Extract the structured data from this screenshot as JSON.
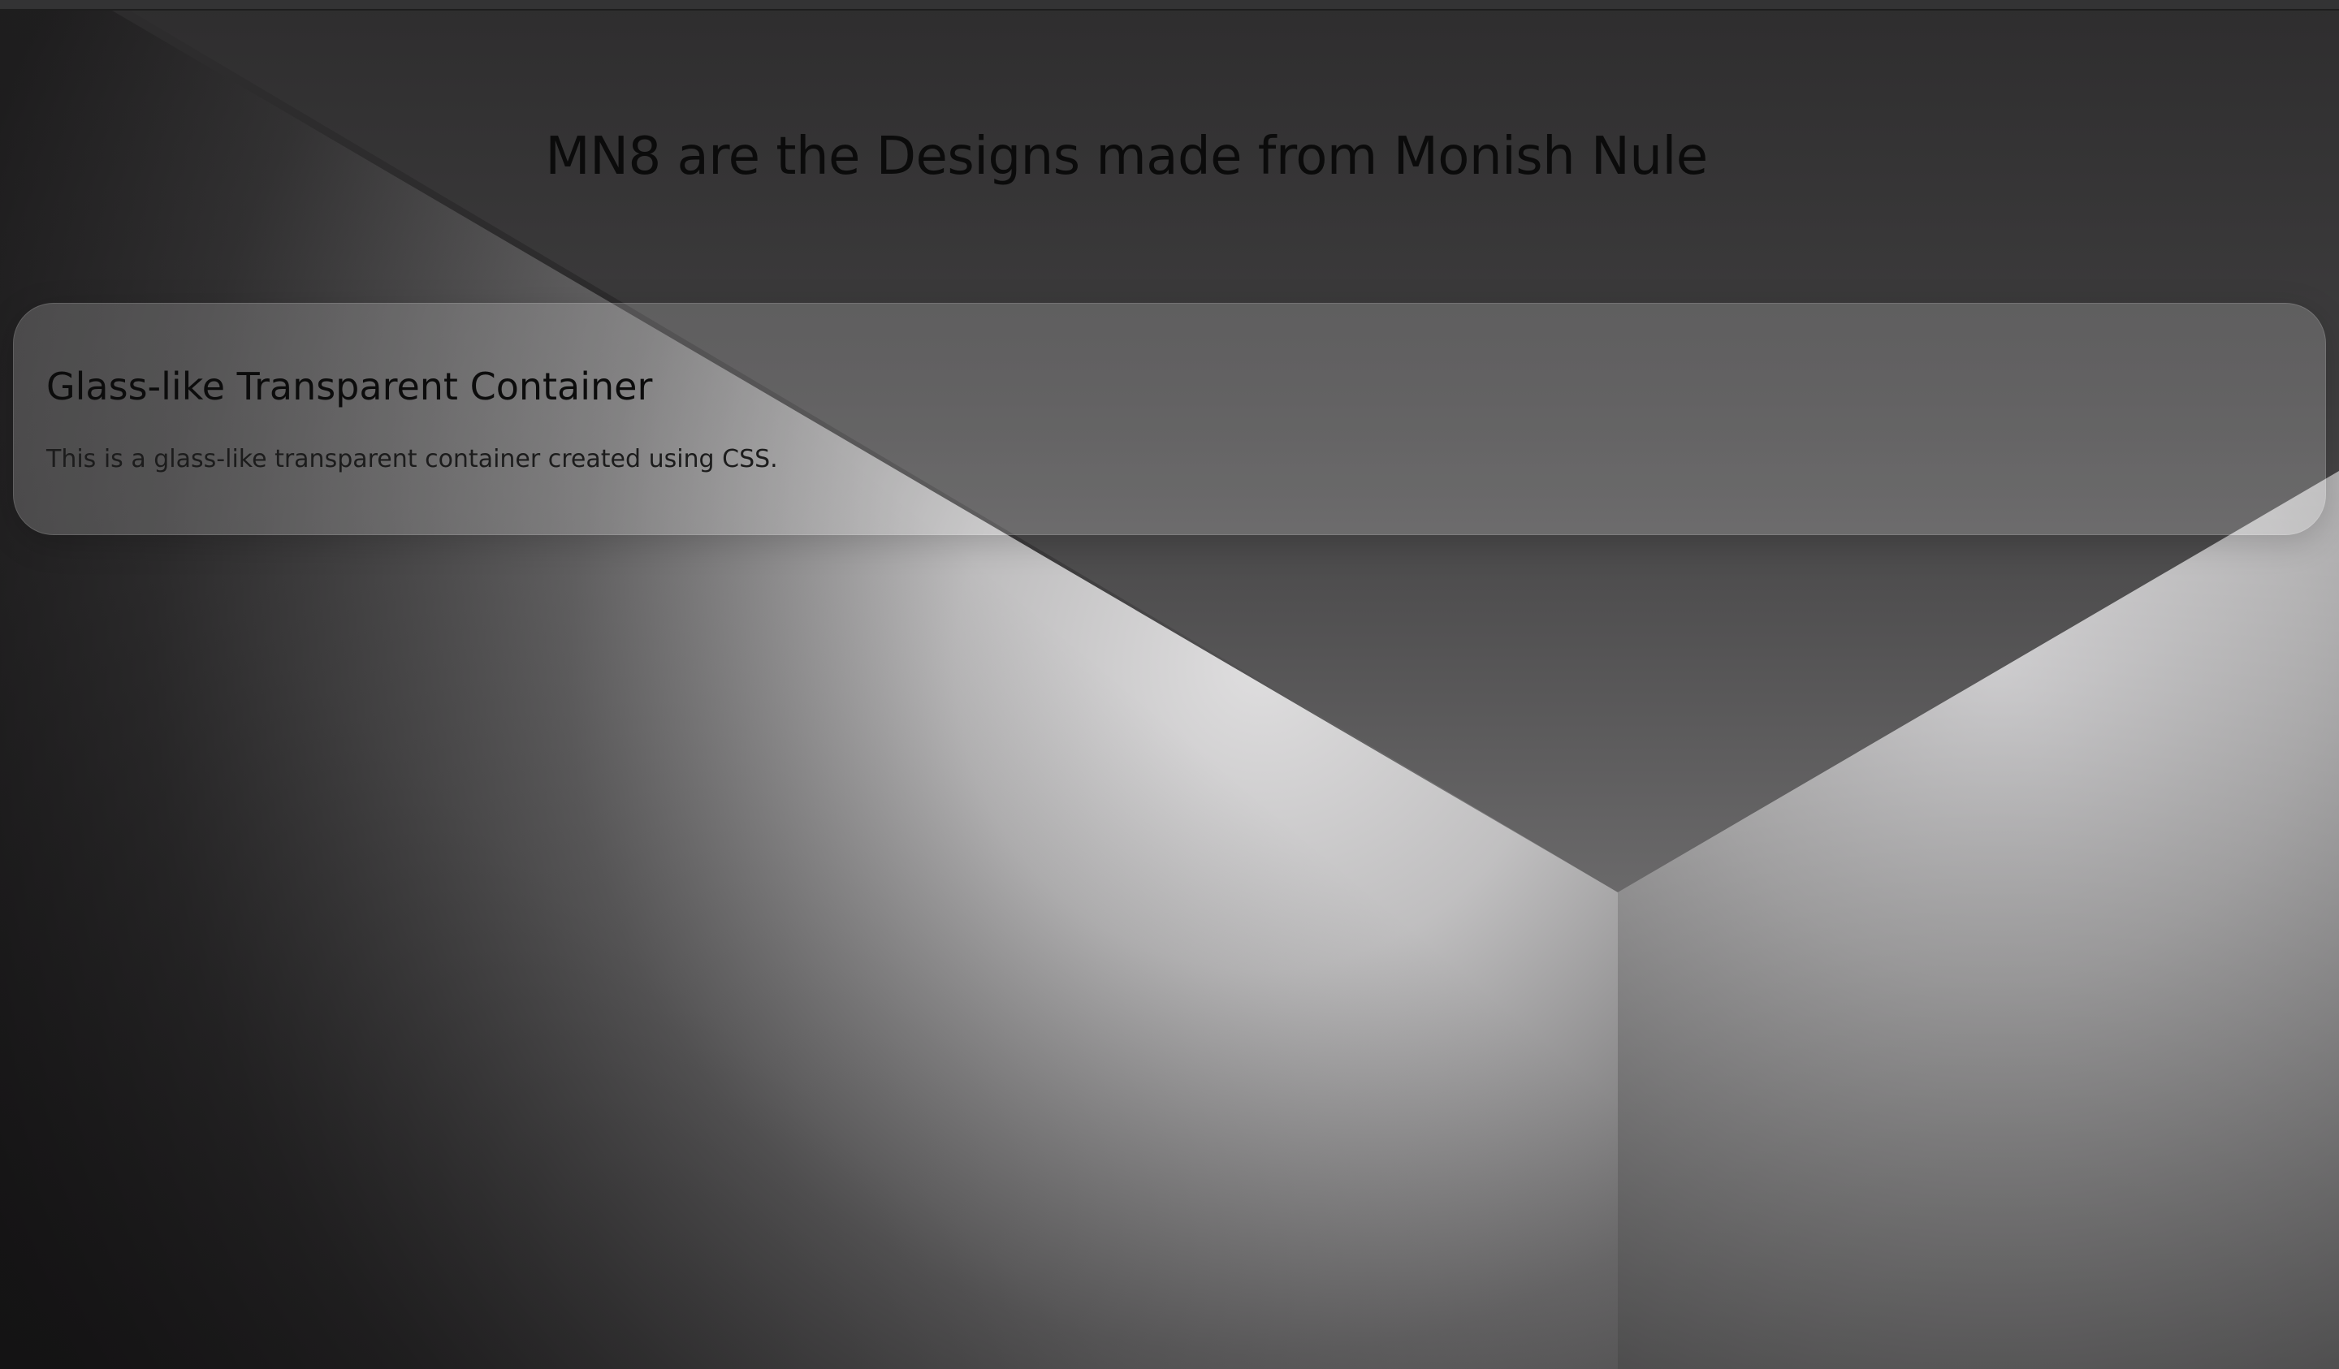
{
  "page": {
    "title": "MN8 are the Designs made from Monish Nule"
  },
  "glass_card": {
    "heading": "Glass-like Transparent Container",
    "body": "This is a glass-like transparent container created using CSS."
  },
  "colors": {
    "background_dark": "#1a191a",
    "background_mid": "#323132",
    "light_highlight": "#e4e3e4",
    "text": "#0b0b0b"
  }
}
